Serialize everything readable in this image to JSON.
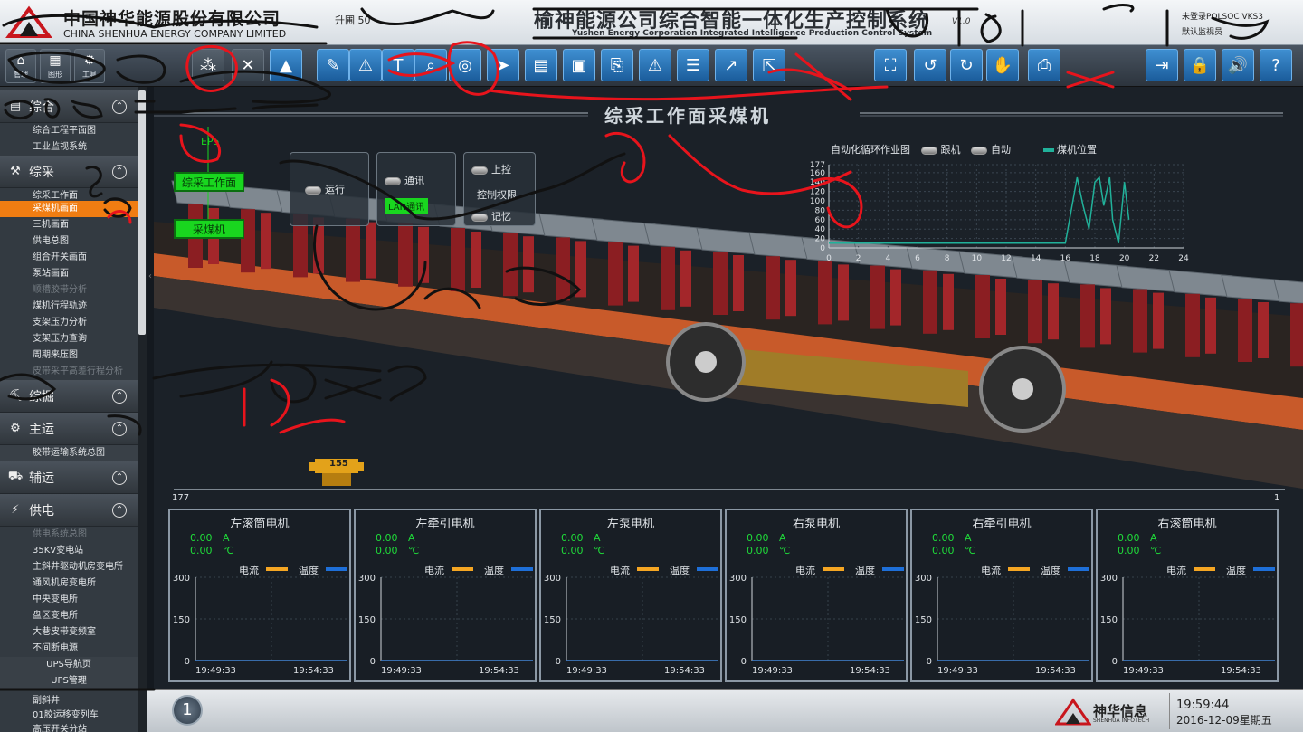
{
  "header": {
    "company_cn": "中国神华能源股份有限公司",
    "company_en": "CHINA SHENHUA ENERGY COMPANY LIMITED",
    "ver_small": "升圃 50",
    "system_cn": "榆神能源公司综合智能一体化生产控制系统",
    "system_en": "Yushen Energy Corporation Integrated Intelligence Production Control System",
    "system_version": "V1.0",
    "user_top": "未登录POLSOC VKS3",
    "user_bottom": "默认监视员"
  },
  "toolbar": {
    "left_buttons": [
      {
        "icon": "home-icon",
        "label": "管理"
      },
      {
        "icon": "grid-icon",
        "label": "图形"
      },
      {
        "icon": "gear-icon",
        "label": "工具"
      }
    ],
    "tool_icons": [
      "network-icon",
      "cross-icon",
      "warning-icon",
      "comment-icon",
      "alert-icon",
      "text-icon",
      "search-icon",
      "cursor-icon",
      "table-icon",
      "image-icon",
      "clipboard-icon",
      "alarm-search-icon",
      "report-search-icon",
      "trend-icon",
      "pointer-icon"
    ],
    "right_icons": [
      "fullscreen-icon",
      "back-icon",
      "forward-icon",
      "hand-icon",
      "print-icon",
      "logout-icon",
      "lock-icon",
      "sound-icon",
      "help-icon"
    ]
  },
  "nav": {
    "sections": [
      {
        "icon": "mining-icon",
        "label": "综采",
        "items": [
          "综采工作面",
          "采煤机画面",
          "三机画面",
          "供电总图",
          "组合开关画面",
          "泵站画面",
          "顺槽胶带分析",
          "煤机行程轨迹",
          "支架压力分析",
          "支架压力查询",
          "周期来压图",
          "皮带采平高差行程分析"
        ]
      },
      {
        "icon": "dig-icon",
        "label": "综掘"
      },
      {
        "icon": "conveyor-icon",
        "label": "主运",
        "items": [
          "胶带运输系统总图"
        ]
      },
      {
        "icon": "truck-icon",
        "label": "辅运"
      },
      {
        "icon": "power-icon",
        "label": "供电",
        "items": [
          "供电系统总图",
          "35KV变电站",
          "主斜井驱动机房变电所",
          "通风机房变电所",
          "中央变电所",
          "盘区变电所",
          "大巷皮带变频室",
          "不间断电源"
        ]
      }
    ],
    "top_items": [
      "综合工程平面图",
      "工业监视系统"
    ],
    "ups_items": [
      "UPS导航页",
      "UPS管理"
    ],
    "bottom_items": [
      "副斜井",
      "01胶运移变列车",
      "高压开关分站"
    ]
  },
  "scene": {
    "title": "综采工作面采煤机",
    "ep_label": "EP5",
    "btn_face": "综采工作面",
    "btn_shearer": "采煤机",
    "ctl_run": "运行",
    "ctl_comm": "通讯",
    "ctl_lan": "LAN通讯",
    "ctl_upper": "上控",
    "ctl_perm": "控制权限",
    "ctl_record": "记忆",
    "chart_title": "自动化循环作业图",
    "chart_led1": "跟机",
    "chart_led2": "自动",
    "legend_pos": "煤机位置",
    "pos_left": "177",
    "pos_right": "1",
    "shearer_pos": "155"
  },
  "chart_data": [
    {
      "type": "line",
      "title": "自动化循环作业图",
      "series": [
        {
          "name": "煤机位置",
          "x": [
            0,
            16,
            16.8,
            17.2,
            17.6,
            18.0,
            18.3,
            18.6,
            19.0,
            19.2,
            19.6,
            20.0,
            20.3
          ],
          "values": [
            10,
            10,
            150,
            90,
            40,
            140,
            150,
            90,
            150,
            60,
            10,
            140,
            60
          ]
        }
      ],
      "xlim": [
        0,
        24
      ],
      "xticks": [
        0,
        2,
        4,
        6,
        8,
        10,
        12,
        14,
        16,
        18,
        20,
        22,
        24
      ],
      "ylim": [
        0,
        177
      ],
      "yticks": [
        0,
        20,
        40,
        60,
        80,
        100,
        120,
        140,
        160,
        177
      ],
      "grid": true,
      "legend": "top-right"
    },
    {
      "type": "line",
      "title": "左滚筒电机",
      "series": [
        {
          "name": "电流",
          "values": [
            0,
            0
          ]
        },
        {
          "name": "温度",
          "values": [
            0,
            0
          ]
        }
      ],
      "ylim": [
        0,
        300
      ],
      "yticks": [
        0,
        150,
        300
      ],
      "x": [
        "19:49:33",
        "19:54:33"
      ]
    },
    {
      "type": "line",
      "title": "左牵引电机",
      "series": [
        {
          "name": "电流",
          "values": [
            0,
            0
          ]
        },
        {
          "name": "温度",
          "values": [
            0,
            0
          ]
        }
      ],
      "ylim": [
        0,
        300
      ],
      "yticks": [
        0,
        150,
        300
      ],
      "x": [
        "19:49:33",
        "19:54:33"
      ]
    },
    {
      "type": "line",
      "title": "左泵电机",
      "series": [
        {
          "name": "电流",
          "values": [
            0,
            0
          ]
        },
        {
          "name": "温度",
          "values": [
            0,
            0
          ]
        }
      ],
      "ylim": [
        0,
        300
      ],
      "yticks": [
        0,
        150,
        300
      ],
      "x": [
        "19:49:33",
        "19:54:33"
      ]
    },
    {
      "type": "line",
      "title": "右泵电机",
      "series": [
        {
          "name": "电流",
          "values": [
            0,
            0
          ]
        },
        {
          "name": "温度",
          "values": [
            0,
            0
          ]
        }
      ],
      "ylim": [
        0,
        300
      ],
      "yticks": [
        0,
        150,
        300
      ],
      "x": [
        "19:49:33",
        "19:54:33"
      ]
    },
    {
      "type": "line",
      "title": "右牵引电机",
      "series": [
        {
          "name": "电流",
          "values": [
            0,
            0
          ]
        },
        {
          "name": "温度",
          "values": [
            0,
            0
          ]
        }
      ],
      "ylim": [
        0,
        300
      ],
      "yticks": [
        0,
        150,
        300
      ],
      "x": [
        "19:49:33",
        "19:54:33"
      ]
    },
    {
      "type": "line",
      "title": "右滚筒电机",
      "series": [
        {
          "name": "电流",
          "values": [
            0,
            0
          ]
        },
        {
          "name": "温度",
          "values": [
            0,
            0
          ]
        }
      ],
      "ylim": [
        0,
        300
      ],
      "yticks": [
        0,
        150,
        300
      ],
      "x": [
        "19:49:33",
        "19:54:33"
      ]
    }
  ],
  "motors": [
    {
      "name": "左滚筒电机",
      "current": "0.00",
      "cur_unit": "A",
      "temp": "0.00",
      "temp_unit": "℃"
    },
    {
      "name": "左牵引电机",
      "current": "0.00",
      "cur_unit": "A",
      "temp": "0.00",
      "temp_unit": "℃"
    },
    {
      "name": "左泵电机",
      "current": "0.00",
      "cur_unit": "A",
      "temp": "0.00",
      "temp_unit": "℃"
    },
    {
      "name": "右泵电机",
      "current": "0.00",
      "cur_unit": "A",
      "temp": "0.00",
      "temp_unit": "℃"
    },
    {
      "name": "右牵引电机",
      "current": "0.00",
      "cur_unit": "A",
      "temp": "0.00",
      "temp_unit": "℃"
    },
    {
      "name": "右滚筒电机",
      "current": "0.00",
      "cur_unit": "A",
      "temp": "0.00",
      "temp_unit": "℃"
    }
  ],
  "motor_legend": {
    "current": "电流",
    "temp": "温度",
    "t_start": "19:49:33",
    "t_end": "19:54:33",
    "y_labels": [
      "300",
      "150",
      "0"
    ]
  },
  "footer": {
    "page": "1",
    "brand": "神华信息",
    "brand_en": "SHENHUA INFOTECH",
    "time": "19:59:44",
    "date": "2016-12-09星期五"
  },
  "colors": {
    "accent": "#f07d12",
    "green": "#19d61f",
    "current": "#f5a623",
    "temp": "#1e6fd8",
    "trace": "#21b19a",
    "annotation_red": "#e8141c"
  }
}
